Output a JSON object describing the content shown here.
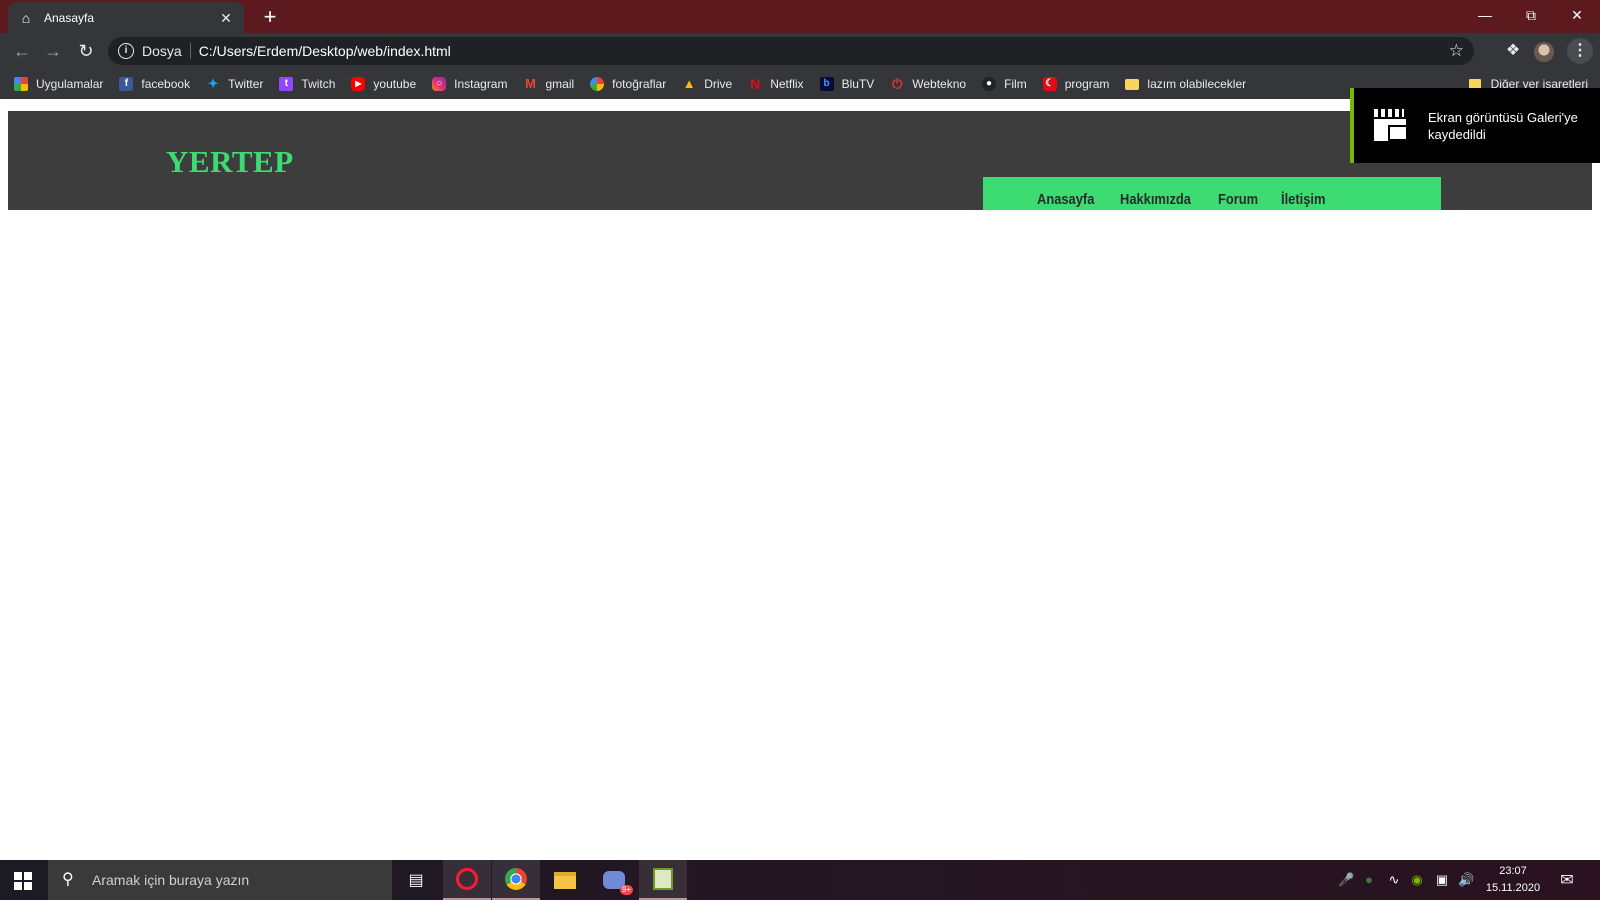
{
  "browser": {
    "tab_title": "Anasayfa",
    "new_tab_symbol": "+",
    "address_scheme": "Dosya",
    "address_url": "C:/Users/Erdem/Desktop/web/index.html"
  },
  "bookmarks": {
    "items": [
      {
        "label": "Uygulamalar",
        "icon": "apps-grid-icon"
      },
      {
        "label": "facebook",
        "icon": "facebook-icon"
      },
      {
        "label": "Twitter",
        "icon": "twitter-icon"
      },
      {
        "label": "Twitch",
        "icon": "twitch-icon"
      },
      {
        "label": "youtube",
        "icon": "youtube-icon"
      },
      {
        "label": "Instagram",
        "icon": "instagram-icon"
      },
      {
        "label": "gmail",
        "icon": "gmail-icon"
      },
      {
        "label": "fotoğraflar",
        "icon": "photos-icon"
      },
      {
        "label": "Drive",
        "icon": "drive-icon"
      },
      {
        "label": "Netflix",
        "icon": "netflix-icon"
      },
      {
        "label": "BluTV",
        "icon": "blutv-icon"
      },
      {
        "label": "Webtekno",
        "icon": "webtekno-icon"
      },
      {
        "label": "Film",
        "icon": "film-icon"
      },
      {
        "label": "program",
        "icon": "program-icon"
      },
      {
        "label": "lazım olabilecekler",
        "icon": "folder-icon"
      }
    ],
    "other": "Diğer yer işaretleri"
  },
  "site": {
    "logo": "YERTEP",
    "nav": [
      "Anasayfa",
      "Hakkımızda",
      "Forum",
      "İletişim"
    ],
    "accent": "#3ddc73",
    "header_bg": "#3d3d3d"
  },
  "toast": {
    "message": "Ekran görüntüsü Galeri'ye kaydedildi",
    "accent": "#76b900"
  },
  "taskbar": {
    "search_placeholder": "Aramak için buraya yazın",
    "time": "23:07",
    "date": "15.11.2020",
    "badge": "9+"
  }
}
